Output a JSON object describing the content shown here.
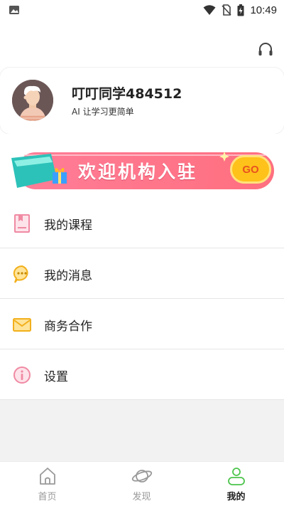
{
  "status_bar": {
    "time": "10:49",
    "icons": [
      "image-icon",
      "wifi-icon",
      "no-sim-icon",
      "battery-charging-icon"
    ]
  },
  "header": {
    "support_icon": "headset-icon"
  },
  "profile": {
    "username": "叮叮同学484512",
    "slogan": "AI 让学习更简单"
  },
  "banner": {
    "text": "欢迎机构入驻",
    "go_label": "GO",
    "colors": {
      "start": "#ff6a88",
      "end": "#ff8f6b",
      "go": "#ffc21a"
    }
  },
  "menu": {
    "items": [
      {
        "label": "我的课程",
        "icon": "book-icon"
      },
      {
        "label": "我的消息",
        "icon": "message-icon"
      },
      {
        "label": "商务合作",
        "icon": "mail-icon"
      },
      {
        "label": "设置",
        "icon": "info-settings-icon"
      }
    ]
  },
  "bottom_nav": {
    "items": [
      {
        "label": "首页",
        "icon": "home-icon",
        "active": false
      },
      {
        "label": "发现",
        "icon": "planet-icon",
        "active": false
      },
      {
        "label": "我的",
        "icon": "profile-icon",
        "active": true
      }
    ],
    "accent": "#4cc44c"
  }
}
